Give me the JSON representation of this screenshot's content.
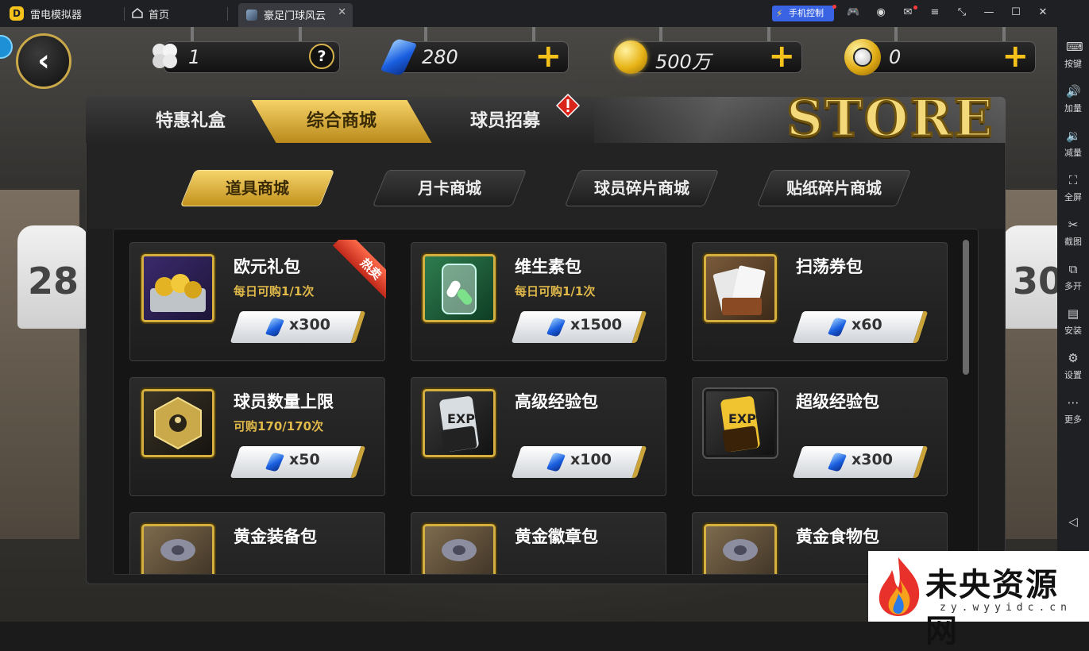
{
  "titlebar": {
    "app_name": "雷电模拟器",
    "home_label": "首页",
    "tab_label": "豪足门球风云",
    "tab_close": "✕",
    "phone_control": "手机控制"
  },
  "sidebar": {
    "items": [
      {
        "label": "按键",
        "icon": "keyboard-icon",
        "glyph": "⌨"
      },
      {
        "label": "加量",
        "icon": "volume-up-icon",
        "glyph": "🔊"
      },
      {
        "label": "减量",
        "icon": "volume-down-icon",
        "glyph": "🔉"
      },
      {
        "label": "全屏",
        "icon": "fullscreen-icon",
        "glyph": "⛶"
      },
      {
        "label": "截图",
        "icon": "scissors-icon",
        "glyph": "✂"
      },
      {
        "label": "多开",
        "icon": "multi-instance-icon",
        "glyph": "⧉"
      },
      {
        "label": "安装",
        "icon": "apk-install-icon",
        "glyph": "▤"
      },
      {
        "label": "设置",
        "icon": "settings-icon",
        "glyph": "⚙"
      },
      {
        "label": "更多",
        "icon": "more-icon",
        "glyph": "⋯"
      }
    ]
  },
  "resources": {
    "clover": "1",
    "help": "?",
    "gems": "280",
    "coins": "500万",
    "football_coins": "0",
    "plus": "+"
  },
  "store": {
    "logo": "STORE",
    "main_tabs": [
      "特惠礼盒",
      "综合商城",
      "球员招募"
    ],
    "active_main_tab": 1,
    "sub_tabs": [
      "道具商城",
      "月卡商城",
      "球员碎片商城",
      "贴纸碎片商城"
    ],
    "active_sub_tab": 0,
    "hot_badge": "热卖",
    "items": [
      {
        "name": "欧元礼包",
        "limit": "每日可购1/1次",
        "price": "x300",
        "hot": true
      },
      {
        "name": "维生素包",
        "limit": "每日可购1/1次",
        "price": "x1500"
      },
      {
        "name": "扫荡券包",
        "limit": "",
        "price": "x60"
      },
      {
        "name": "球员数量上限",
        "limit": "可购170/170次",
        "price": "x50"
      },
      {
        "name": "高级经验包",
        "limit": "",
        "price": "x100"
      },
      {
        "name": "超级经验包",
        "limit": "",
        "price": "x300"
      },
      {
        "name": "黄金装备包",
        "limit": "",
        "price": ""
      },
      {
        "name": "黄金徽章包",
        "limit": "",
        "price": ""
      },
      {
        "name": "黄金食物包",
        "limit": "",
        "price": ""
      }
    ]
  },
  "watermark": {
    "text": "未央资源网",
    "url": "zy.wyyidc.cn"
  },
  "jerseys": [
    "28",
    "30"
  ],
  "exp_label": "EXP",
  "colors": {
    "accent_gold": "#f4c21a",
    "phone_button": "#3a63e4",
    "hot_red": "#c0281a"
  }
}
